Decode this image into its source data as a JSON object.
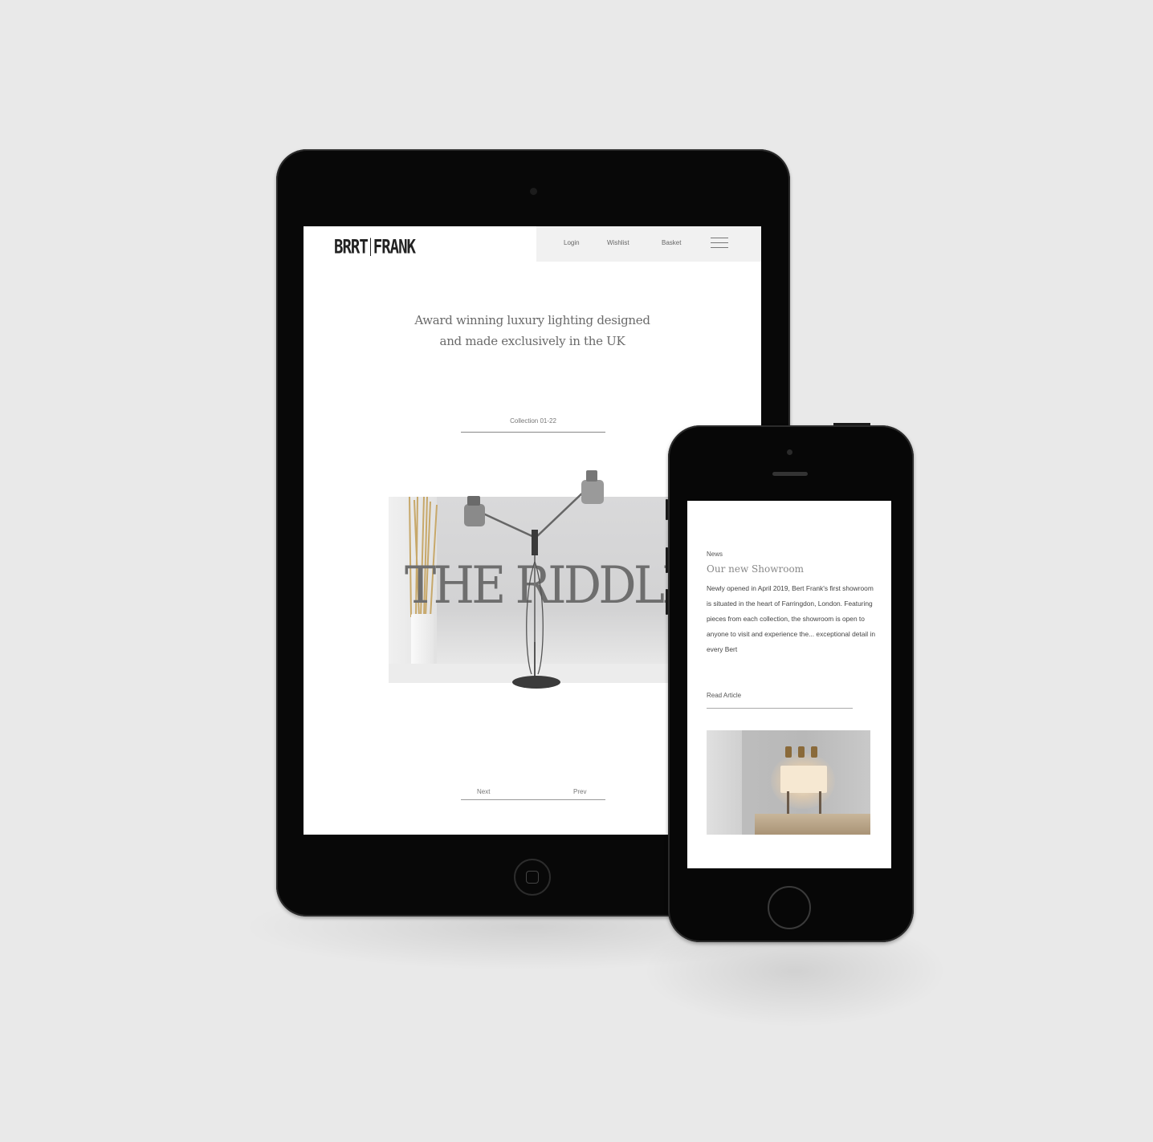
{
  "tablet": {
    "logo": {
      "left": "BRRT",
      "right": "FRANK"
    },
    "nav": {
      "login": "Login",
      "wishlist": "Wishlist",
      "basket": "Basket"
    },
    "tagline_line1": "Award winning luxury lighting designed",
    "tagline_line2": "and made exclusively in the UK",
    "collection_label": "Collection 01-22",
    "hero_title": "THE RIDDLE",
    "pager": {
      "next": "Next",
      "prev": "Prev"
    }
  },
  "phone": {
    "label": "News",
    "title": "Our new Showroom",
    "body": "Newly opened in April 2019, Bert Frank's first showroom is situated in the heart of Farringdon, London. Featuring pieces from each collection, the showroom is open to anyone to visit and experience the... exceptional detail in every Bert",
    "read_link": "Read Article"
  },
  "colors": {
    "background": "#e9e9e9",
    "device_body": "#080808",
    "screen": "#ffffff",
    "nav_background": "#f1f1f1"
  },
  "icons": [
    "menu-icon",
    "tablet-home-button",
    "phone-home-button",
    "camera"
  ]
}
